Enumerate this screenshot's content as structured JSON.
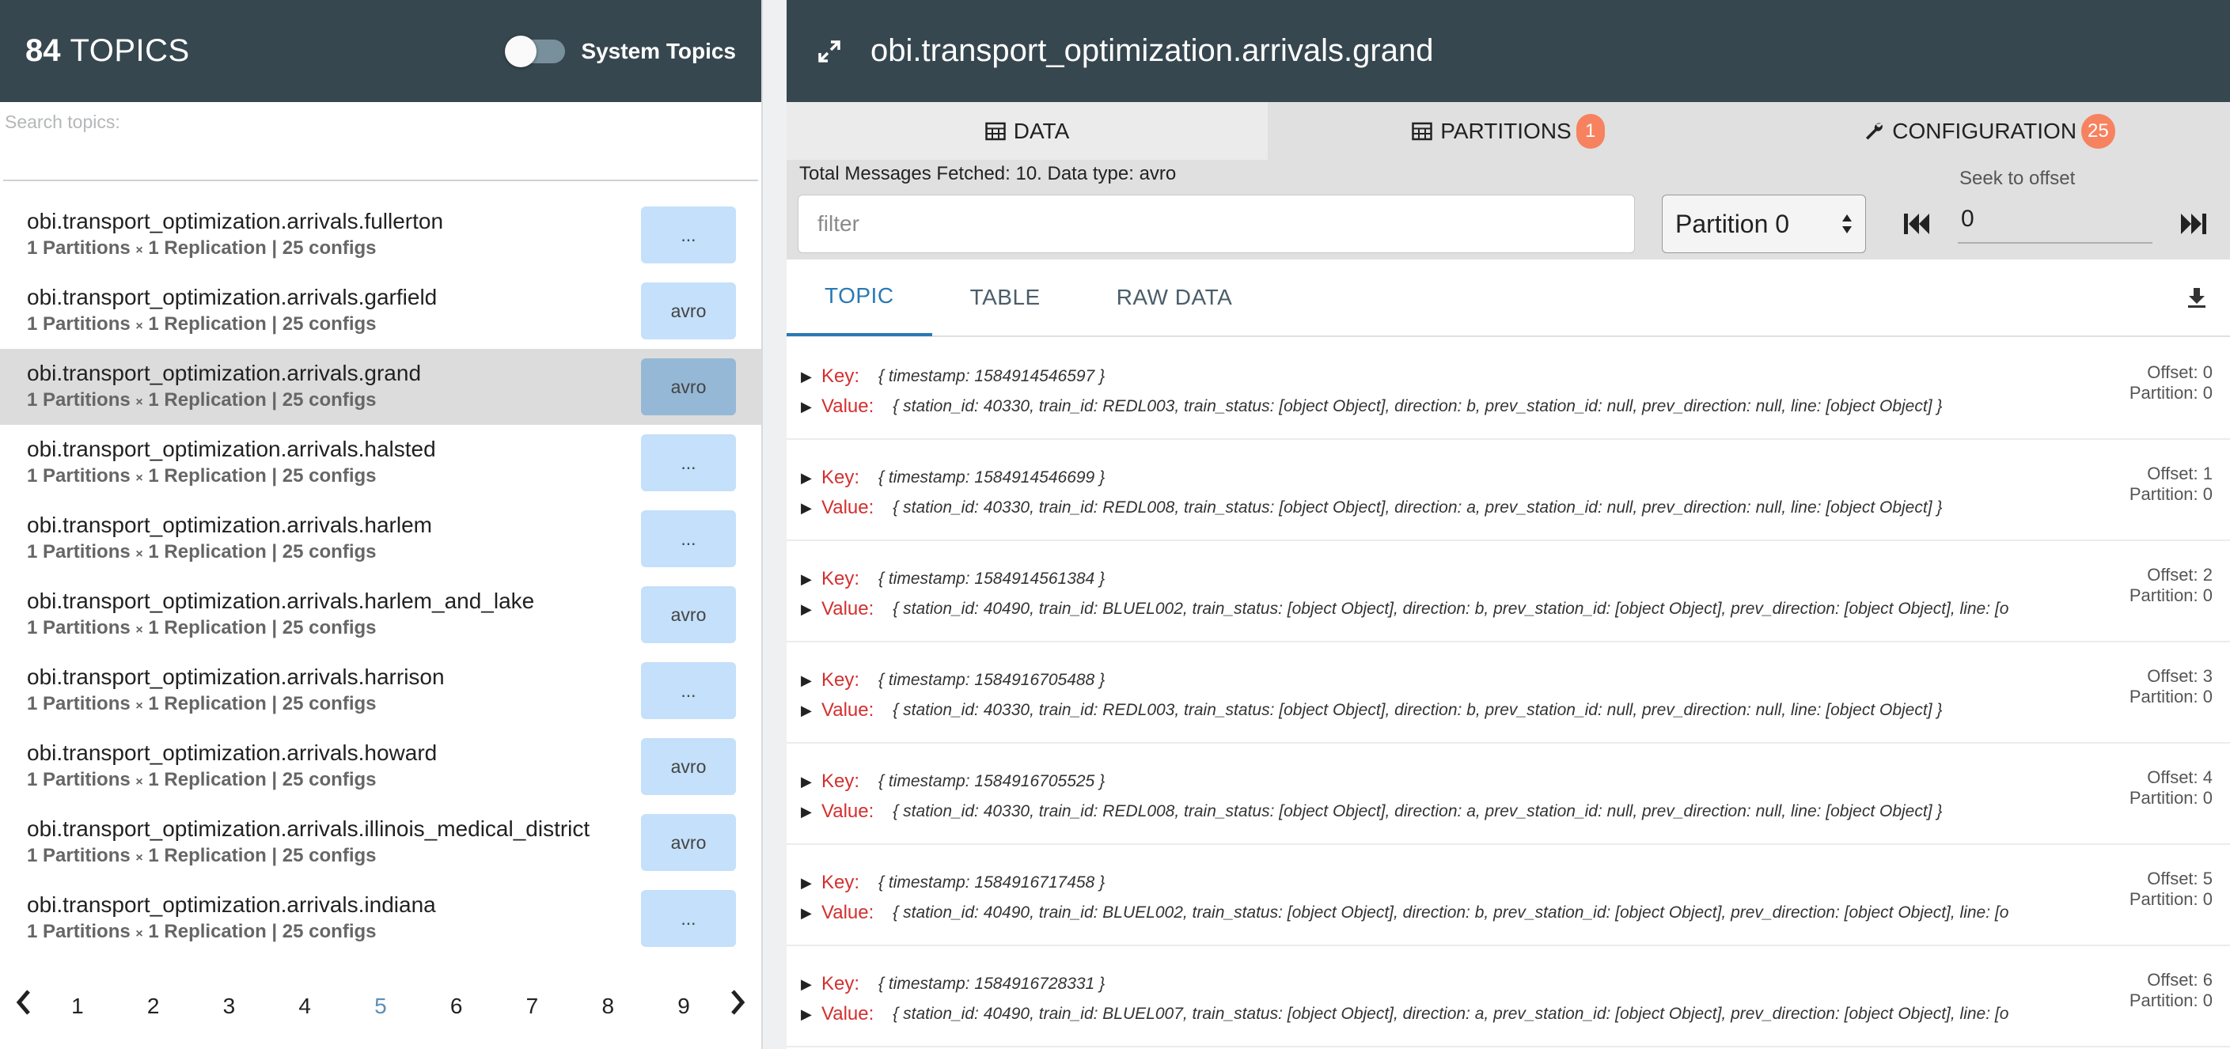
{
  "left": {
    "topic_count": "84",
    "topic_word": "TOPICS",
    "system_topics_label": "System Topics",
    "search_label": "Search topics:",
    "topics": [
      {
        "name": "obi.transport_optimization.arrivals.fullerton",
        "partitions": "1 Partitions",
        "replication": "1 Replication | 25 configs",
        "button": "...",
        "selected": false
      },
      {
        "name": "obi.transport_optimization.arrivals.garfield",
        "partitions": "1 Partitions",
        "replication": "1 Replication | 25 configs",
        "button": "avro",
        "selected": false
      },
      {
        "name": "obi.transport_optimization.arrivals.grand",
        "partitions": "1 Partitions",
        "replication": "1 Replication | 25 configs",
        "button": "avro",
        "selected": true
      },
      {
        "name": "obi.transport_optimization.arrivals.halsted",
        "partitions": "1 Partitions",
        "replication": "1 Replication | 25 configs",
        "button": "...",
        "selected": false
      },
      {
        "name": "obi.transport_optimization.arrivals.harlem",
        "partitions": "1 Partitions",
        "replication": "1 Replication | 25 configs",
        "button": "...",
        "selected": false
      },
      {
        "name": "obi.transport_optimization.arrivals.harlem_and_lake",
        "partitions": "1 Partitions",
        "replication": "1 Replication | 25 configs",
        "button": "avro",
        "selected": false
      },
      {
        "name": "obi.transport_optimization.arrivals.harrison",
        "partitions": "1 Partitions",
        "replication": "1 Replication | 25 configs",
        "button": "...",
        "selected": false
      },
      {
        "name": "obi.transport_optimization.arrivals.howard",
        "partitions": "1 Partitions",
        "replication": "1 Replication | 25 configs",
        "button": "avro",
        "selected": false
      },
      {
        "name": "obi.transport_optimization.arrivals.illinois_medical_district",
        "partitions": "1 Partitions",
        "replication": "1 Replication | 25 configs",
        "button": "avro",
        "selected": false
      },
      {
        "name": "obi.transport_optimization.arrivals.indiana",
        "partitions": "1 Partitions",
        "replication": "1 Replication | 25 configs",
        "button": "...",
        "selected": false
      }
    ],
    "pagination": {
      "pages": [
        "1",
        "2",
        "3",
        "4",
        "5",
        "6",
        "7",
        "8",
        "9"
      ],
      "current": "5"
    }
  },
  "right": {
    "title": "obi.transport_optimization.arrivals.grand",
    "tabs": {
      "data": "DATA",
      "partitions": "PARTITIONS",
      "partitions_badge": "1",
      "configuration": "CONFIGURATION",
      "configuration_badge": "25"
    },
    "fetched_text": "Total Messages Fetched: 10. Data type: avro",
    "filter_placeholder": "filter",
    "partition_selected": "Partition 0",
    "seek_label": "Seek to offset",
    "seek_value": "0",
    "subtabs": [
      "TOPIC",
      "TABLE",
      "RAW DATA"
    ],
    "key_label": "Key:",
    "value_label": "Value:",
    "messages": [
      {
        "key": "{ timestamp: 1584914546597 }",
        "value": "{ station_id: 40330, train_id: REDL003, train_status: [object Object], direction: b, prev_station_id: null, prev_direction: null, line: [object Object] }",
        "offset": "Offset: 0",
        "partition": "Partition: 0"
      },
      {
        "key": "{ timestamp: 1584914546699 }",
        "value": "{ station_id: 40330, train_id: REDL008, train_status: [object Object], direction: a, prev_station_id: null, prev_direction: null, line: [object Object] }",
        "offset": "Offset: 1",
        "partition": "Partition: 0"
      },
      {
        "key": "{ timestamp: 1584914561384 }",
        "value": "{ station_id: 40490, train_id: BLUEL002, train_status: [object Object], direction: b, prev_station_id: [object Object], prev_direction: [object Object], line: [o",
        "offset": "Offset: 2",
        "partition": "Partition: 0"
      },
      {
        "key": "{ timestamp: 1584916705488 }",
        "value": "{ station_id: 40330, train_id: REDL003, train_status: [object Object], direction: b, prev_station_id: null, prev_direction: null, line: [object Object] }",
        "offset": "Offset: 3",
        "partition": "Partition: 0"
      },
      {
        "key": "{ timestamp: 1584916705525 }",
        "value": "{ station_id: 40330, train_id: REDL008, train_status: [object Object], direction: a, prev_station_id: null, prev_direction: null, line: [object Object] }",
        "offset": "Offset: 4",
        "partition": "Partition: 0"
      },
      {
        "key": "{ timestamp: 1584916717458 }",
        "value": "{ station_id: 40490, train_id: BLUEL002, train_status: [object Object], direction: b, prev_station_id: [object Object], prev_direction: [object Object], line: [o",
        "offset": "Offset: 5",
        "partition": "Partition: 0"
      },
      {
        "key": "{ timestamp: 1584916728331 }",
        "value": "{ station_id: 40490, train_id: BLUEL007, train_status: [object Object], direction: a, prev_station_id: [object Object], prev_direction: [object Object], line: [o",
        "offset": "Offset: 6",
        "partition": "Partition: 0"
      }
    ]
  },
  "colors": {
    "header_bg": "#37474f",
    "badge": "#f7825f",
    "link_active": "#2979b5",
    "label_red": "#d32f2f",
    "topic_button": "#c4e0fa"
  },
  "icons": {
    "expand": "expand-icon",
    "table": "table-icon",
    "wrench": "wrench-icon",
    "skip_first": "skip-first-icon",
    "skip_last": "skip-last-icon",
    "download": "download-icon",
    "chevron_left": "chevron-left-icon",
    "chevron_right": "chevron-right-icon"
  }
}
